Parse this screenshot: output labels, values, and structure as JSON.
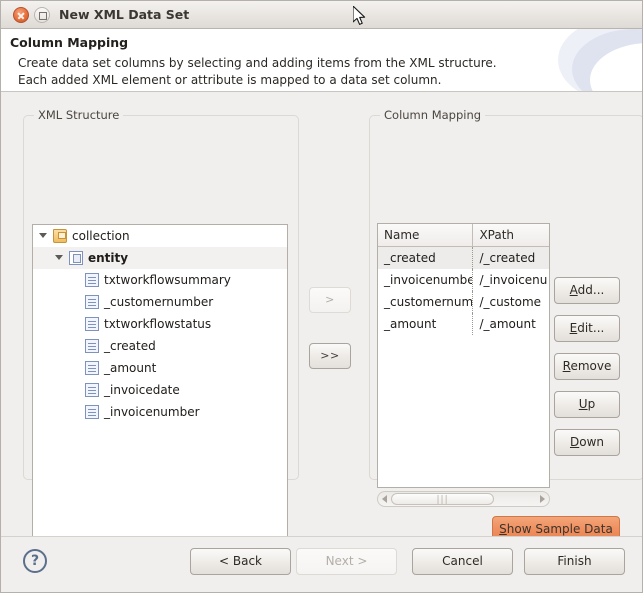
{
  "window": {
    "title": "New XML Data Set",
    "close_icon": "close-icon",
    "maximize_icon": "maximize-icon"
  },
  "banner": {
    "title": "Column Mapping",
    "description_line1": "Create data set columns by selecting and adding items from the XML structure.",
    "description_line2": "Each added XML element or attribute is mapped to a data set column."
  },
  "xml_structure": {
    "group_label": "XML Structure",
    "tree": [
      {
        "label": "collection",
        "icon": "folder-collection-icon",
        "indent": 0,
        "expanded": true,
        "bold": false,
        "selected": false
      },
      {
        "label": "entity",
        "icon": "layers-entity-icon",
        "indent": 1,
        "expanded": true,
        "bold": true,
        "selected": true
      },
      {
        "label": "txtworkflowsummary",
        "icon": "xml-element-icon",
        "indent": 2,
        "expanded": null,
        "bold": false,
        "selected": false
      },
      {
        "label": "_customernumber",
        "icon": "xml-element-icon",
        "indent": 2,
        "expanded": null,
        "bold": false,
        "selected": false
      },
      {
        "label": "txtworkflowstatus",
        "icon": "xml-element-icon",
        "indent": 2,
        "expanded": null,
        "bold": false,
        "selected": false
      },
      {
        "label": "_created",
        "icon": "xml-element-icon",
        "indent": 2,
        "expanded": null,
        "bold": false,
        "selected": false
      },
      {
        "label": "_amount",
        "icon": "xml-element-icon",
        "indent": 2,
        "expanded": null,
        "bold": false,
        "selected": false
      },
      {
        "label": "_invoicedate",
        "icon": "xml-element-icon",
        "indent": 2,
        "expanded": null,
        "bold": false,
        "selected": false
      },
      {
        "label": "_invoicenumber",
        "icon": "xml-element-icon",
        "indent": 2,
        "expanded": null,
        "bold": false,
        "selected": false
      }
    ]
  },
  "transfer": {
    "add_one_label": ">",
    "add_one_enabled": false,
    "add_all_label": ">>",
    "add_all_enabled": true
  },
  "column_mapping": {
    "group_label": "Column Mapping",
    "columns": [
      "Name",
      "XPath"
    ],
    "rows": [
      {
        "name": "_created",
        "xpath": "/_created",
        "selected": true
      },
      {
        "name": "_invoicenumbe",
        "xpath": "/_invoicenu",
        "selected": false
      },
      {
        "name": "_customernum",
        "xpath": "/_custome",
        "selected": false
      },
      {
        "name": "_amount",
        "xpath": "/_amount",
        "selected": false
      }
    ],
    "buttons": [
      {
        "id": "add",
        "mnemonic": "A",
        "rest": "dd..."
      },
      {
        "id": "edit",
        "mnemonic": "E",
        "rest": "dit..."
      },
      {
        "id": "remove",
        "mnemonic": "R",
        "rest": "emove"
      },
      {
        "id": "up",
        "mnemonic": "U",
        "rest": "p"
      },
      {
        "id": "down",
        "mnemonic": "D",
        "rest": "own"
      }
    ],
    "show_sample": {
      "mnemonic": "S",
      "rest": "how Sample Data"
    },
    "scrollbar": {
      "left_arrow_icon": "scroll-left-arrow-icon",
      "right_arrow_icon": "scroll-right-arrow-icon",
      "grip": "|||"
    }
  },
  "footer": {
    "help_icon": "help-question-icon",
    "help_glyph": "?",
    "buttons": [
      {
        "id": "back",
        "label": "< Back",
        "enabled": true
      },
      {
        "id": "next",
        "label": "Next >",
        "enabled": false
      },
      {
        "id": "cancel",
        "label": "Cancel",
        "enabled": true
      },
      {
        "id": "finish",
        "label": "Finish",
        "enabled": true
      }
    ]
  },
  "colors": {
    "window_bg": "#f1efed",
    "accent_orange": "#ee8f5f",
    "tree_bg": "#ffffff",
    "border": "#b3aea8"
  }
}
